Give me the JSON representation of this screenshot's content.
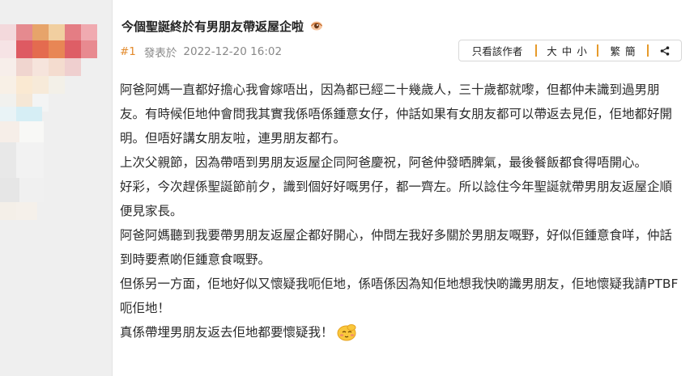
{
  "post": {
    "title": "今個聖誕終於有男朋友帶返屋企啦",
    "floor": "#1",
    "posted_label": "發表於",
    "posted_time": "2022-12-20 16:02"
  },
  "toolbar": {
    "owner_only": "只看該作者",
    "size_large": "大",
    "size_medium": "中",
    "size_small": "小",
    "trad": "繁",
    "simp": "簡"
  },
  "content": {
    "paragraphs": [
      "阿爸阿媽一直都好擔心我會嫁唔出，因為都已經二十幾歲人，三十歲都就嚟，但都仲未識到過男朋友。有時候佢地仲會問我其實我係唔係鍾意女仔，仲話如果有女朋友都可以帶返去見佢，佢地都好開明。但唔好講女朋友啦，連男朋友都冇。",
      "上次父親節，因為帶唔到男朋友返屋企同阿爸慶祝，阿爸仲發晒脾氣，最後餐飯都食得唔開心。",
      "好彩，今次趕係聖誕節前夕，識到個好好嘅男仔，都一齊左。所以諗住今年聖誕就帶男朋友返屋企順便見家長。",
      "阿爸阿媽聽到我要帶男朋友返屋企都好開心，仲問左我好多關於男朋友嘅野，好似佢鍾意食咩，仲話到時要煮啲佢鍾意食嘅野。",
      "但係另一方面，佢地好似又懷疑我呃佢地，係唔係因為知佢地想我快啲識男朋友，佢地懷疑我請PTBF呃佢地！",
      "真係帶埋男朋友返去佢地都要懷疑我！"
    ]
  },
  "colors": {
    "accent": "#e38a2b",
    "separator": "#e69a2a",
    "meta_text": "#888888",
    "sidebar_bg": "#efefef"
  },
  "icons": {
    "hot": "hot-icon",
    "share": "share-icon",
    "emoji": "shy-smiley-emoji"
  }
}
